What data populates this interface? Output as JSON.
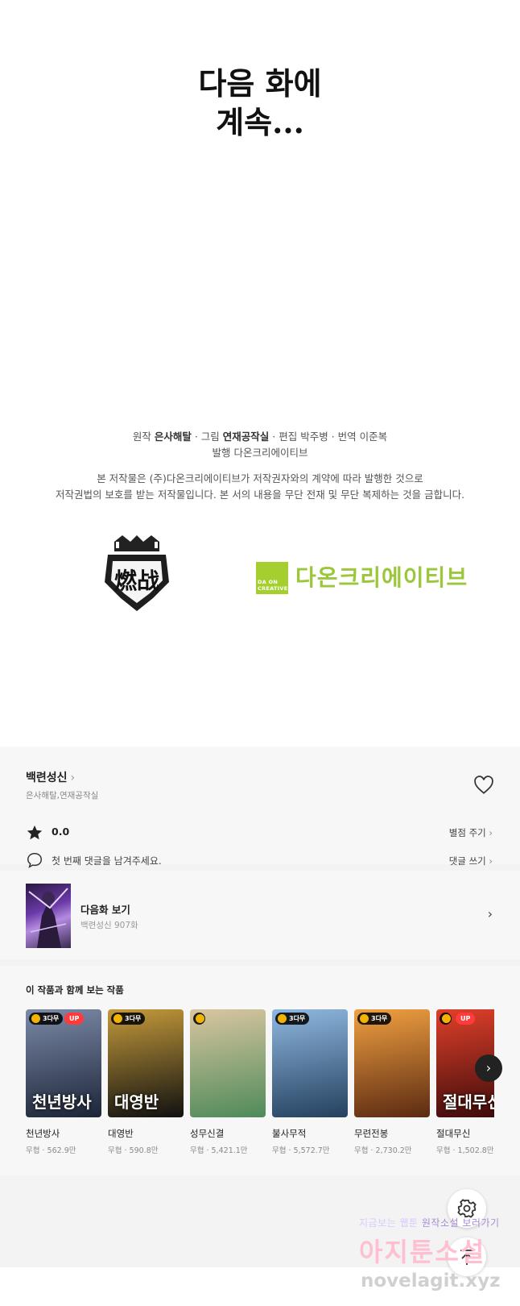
{
  "end_card": {
    "line1": "다음 화에",
    "line2": "계속..."
  },
  "credits": {
    "original_label": "원작",
    "original": "은사해탈",
    "art_label": "그림",
    "art": "연재공작실",
    "edit_label": "편집",
    "edit": "박주병",
    "translate_label": "번역",
    "translate": "이준복",
    "publish_label": "발행",
    "publish": "다온크리에이티브",
    "notice1": "본 저작물은 (주)다온크리에이티브가 저작권자와의 계약에 따라 발행한 것으로",
    "notice2": "저작권법의 보호를 받는 저작물입니다. 본 서의 내용을 무단 전재 및 무단 복제하는 것을 금합니다."
  },
  "logos": {
    "studio_logo_text": "燃战",
    "publisher_square_text": "DA ON CREATIVE",
    "publisher_name": "다온크리에이티브",
    "publisher_color": "#9bc73b"
  },
  "work": {
    "title": "백련성신",
    "authors": "은사해탈,연재공작실",
    "rating": "0.0",
    "rate_label": "별점 주기",
    "comment_prompt": "첫 번째 댓글을 남겨주세요.",
    "comment_label": "댓글 쓰기"
  },
  "next_episode": {
    "label": "다음화 보기",
    "subtitle": "백련성신 907화"
  },
  "recommend": {
    "heading": "이 작품과 함께 보는 작품",
    "items": [
      {
        "name": "천년방사",
        "meta": "무협 · 562.9만",
        "badge": "3다무",
        "up": "UP",
        "cover_text": "천년방사",
        "c1": "#1c2538",
        "c2": "#7c8aa8"
      },
      {
        "name": "대영반",
        "meta": "무협 · 590.8만",
        "badge": "3다무",
        "up": "",
        "cover_text": "대영반",
        "c1": "#111111",
        "c2": "#c49a3a"
      },
      {
        "name": "성무신결",
        "meta": "무협 · 5,421.1만",
        "badge": "",
        "up": "",
        "cover_text": "",
        "c1": "#4f8a5a",
        "c2": "#d9c6a0"
      },
      {
        "name": "불사무적",
        "meta": "무협 · 5,572.7만",
        "badge": "3다무",
        "up": "",
        "cover_text": "",
        "c1": "#24405e",
        "c2": "#8fb8e0"
      },
      {
        "name": "무련전봉",
        "meta": "무협 · 2,730.2만",
        "badge": "3다무",
        "up": "",
        "cover_text": "",
        "c1": "#5b2a12",
        "c2": "#f0a040"
      },
      {
        "name": "절대무신",
        "meta": "무협 · 1,502.8만",
        "badge": "",
        "up": "UP",
        "cover_text": "절대무신",
        "c1": "#3a0a0a",
        "c2": "#e0402a"
      }
    ]
  },
  "watermark": {
    "line1a": "지금보는 웹툰",
    "line1b": "원작소설 보러가기",
    "line2": "아지툰소설",
    "line3": "novelagit.xyz"
  }
}
